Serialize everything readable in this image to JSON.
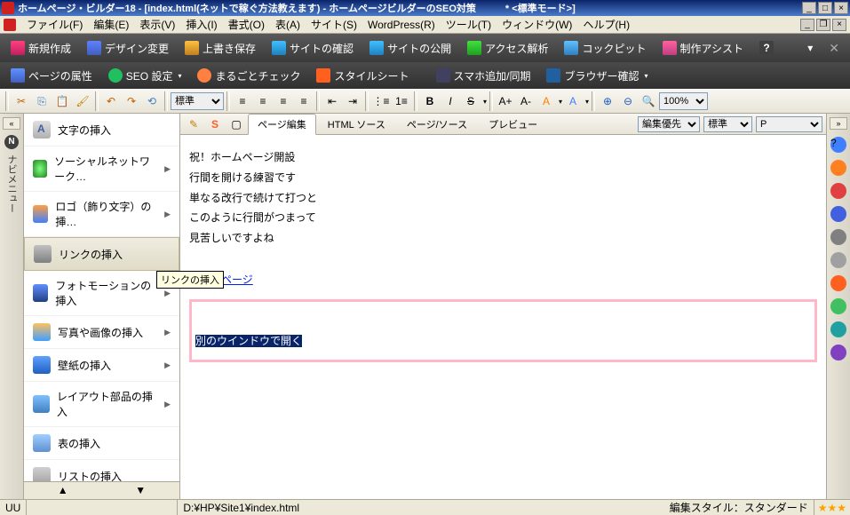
{
  "title": "ホームページ・ビルダー18 - [index.html(ネットで稼ぐ方法教えます) - ホームページビルダーのSEO対策　　　* <標準モード>]",
  "menubar": [
    "ファイル(F)",
    "編集(E)",
    "表示(V)",
    "挿入(I)",
    "書式(O)",
    "表(A)",
    "サイト(S)",
    "WordPress(R)",
    "ツール(T)",
    "ウィンドウ(W)",
    "ヘルプ(H)"
  ],
  "toolbar1": {
    "new": "新規作成",
    "design": "デザイン変更",
    "save": "上書き保存",
    "sitecheck": "サイトの確認",
    "publish": "サイトの公開",
    "access": "アクセス解析",
    "cockpit": "コックピット",
    "assist": "制作アシスト"
  },
  "toolbar2": {
    "page_attr": "ページの属性",
    "seo": "SEO 設定",
    "whole": "まるごとチェック",
    "style": "スタイルシート",
    "phone": "スマホ追加/同期",
    "browser": "ブラウザー確認"
  },
  "format_select": "標準",
  "zoom": "100%",
  "nav_label": "ナビメニュー",
  "sidebar": {
    "items": [
      {
        "label": "文字の挿入",
        "icon": "text",
        "arrow": false
      },
      {
        "label": "ソーシャルネットワーク…",
        "icon": "social",
        "arrow": true
      },
      {
        "label": "ロゴ（飾り文字）の挿…",
        "icon": "logo",
        "arrow": true
      },
      {
        "label": "リンクの挿入",
        "icon": "link",
        "arrow": false,
        "selected": true
      },
      {
        "label": "フォトモーションの挿入",
        "icon": "photo",
        "arrow": true
      },
      {
        "label": "写真や画像の挿入",
        "icon": "image",
        "arrow": true
      },
      {
        "label": "壁紙の挿入",
        "icon": "wall",
        "arrow": true
      },
      {
        "label": "レイアウト部品の挿入",
        "icon": "layout",
        "arrow": true
      },
      {
        "label": "表の挿入",
        "icon": "table",
        "arrow": false
      },
      {
        "label": "リストの挿入",
        "icon": "list",
        "arrow": false
      }
    ]
  },
  "tooltip": "リンクの挿入",
  "editor_tabs": {
    "page_edit": "ページ編集",
    "html_src": "HTML ソース",
    "page_src": "ページ/ソース",
    "preview": "プレビュー"
  },
  "editor_selects": {
    "priority": "編集優先",
    "std": "標準",
    "p": "P"
  },
  "content": {
    "l1": "祝！ホームページ開設",
    "l2": "行間を開ける練習です",
    "l3": "単なる改行で続けて打つと",
    "l4": "このように行間がつまって",
    "l5": "見苦しいですよね",
    "link": "最初のページ",
    "selected": "別のウインドウで開く"
  },
  "status": {
    "uu": "UU",
    "path": "D:¥HP¥Site1¥index.html",
    "style": "編集スタイル：スタンダード",
    "stars": "★★★"
  }
}
